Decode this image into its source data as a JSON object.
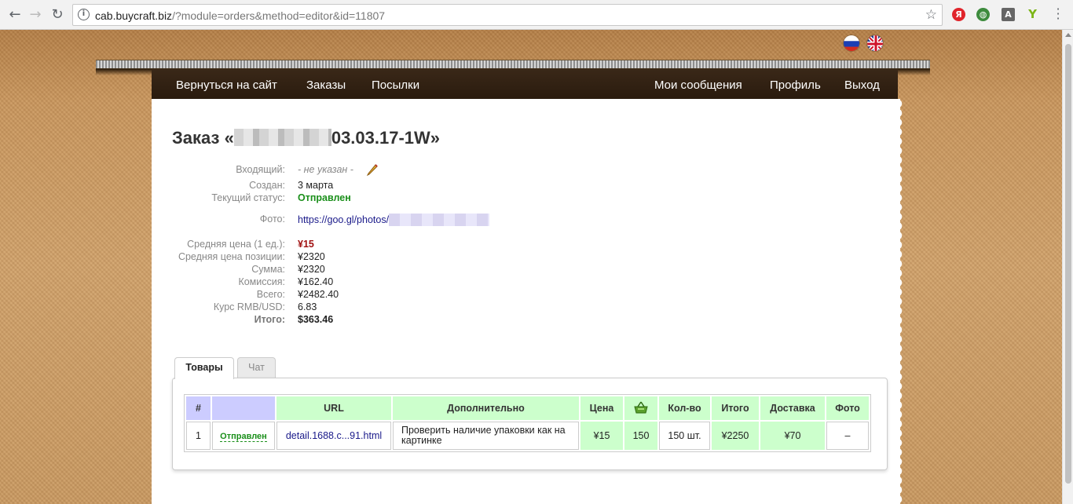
{
  "browser": {
    "url_host": "cab.buycraft.biz",
    "url_path": "/?module=orders&method=editor&id=11807",
    "ext_yandex": "Я",
    "ext_translate": "A"
  },
  "nav": {
    "back_to_site": "Вернуться на сайт",
    "orders": "Заказы",
    "parcels": "Посылки",
    "messages": "Мои сообщения",
    "profile": "Профиль",
    "logout": "Выход"
  },
  "order": {
    "title_prefix": "Заказ «",
    "title_suffix": "03.03.17-1W»",
    "fields": {
      "incoming_label": "Входящий:",
      "incoming_value": "- не указан -",
      "created_label": "Создан:",
      "created_value": "3 марта",
      "status_label": "Текущий статус:",
      "status_value": "Отправлен",
      "photo_label": "Фото:",
      "photo_value": "https://goo.gl/photos/",
      "avg_price_label": "Средняя цена (1 ед.):",
      "avg_price_value": "¥15",
      "avg_pos_label": "Средняя цена позиции:",
      "avg_pos_value": "¥2320",
      "sum_label": "Сумма:",
      "sum_value": "¥2320",
      "commission_label": "Комиссия:",
      "commission_value": "¥162.40",
      "total_label": "Всего:",
      "total_value": "¥2482.40",
      "rate_label": "Курс RMB/USD:",
      "rate_value": "6.83",
      "grand_label": "Итого:",
      "grand_value": "$363.46"
    }
  },
  "tabs": {
    "goods": "Товары",
    "chat": "Чат"
  },
  "table": {
    "headers": {
      "num": "#",
      "url": "URL",
      "extra": "Дополнительно",
      "price": "Цена",
      "qty": "Кол-во",
      "total": "Итого",
      "delivery": "Доставка",
      "photo": "Фото"
    },
    "rows": [
      {
        "num": "1",
        "status": "Отправлен",
        "url": "detail.1688.c...91.html",
        "extra": "Проверить наличие упаковки как на картинке",
        "price": "¥15",
        "basket": "150",
        "qty": "150 шт.",
        "total": "¥2250",
        "delivery": "¥70",
        "photo": "–"
      }
    ]
  },
  "colors": {
    "nav_bg": "#2a1b0e",
    "header_green": "#ccffcc",
    "header_blue": "#ccccff",
    "status_green": "#1a8f1a",
    "price_red": "#a01010"
  }
}
